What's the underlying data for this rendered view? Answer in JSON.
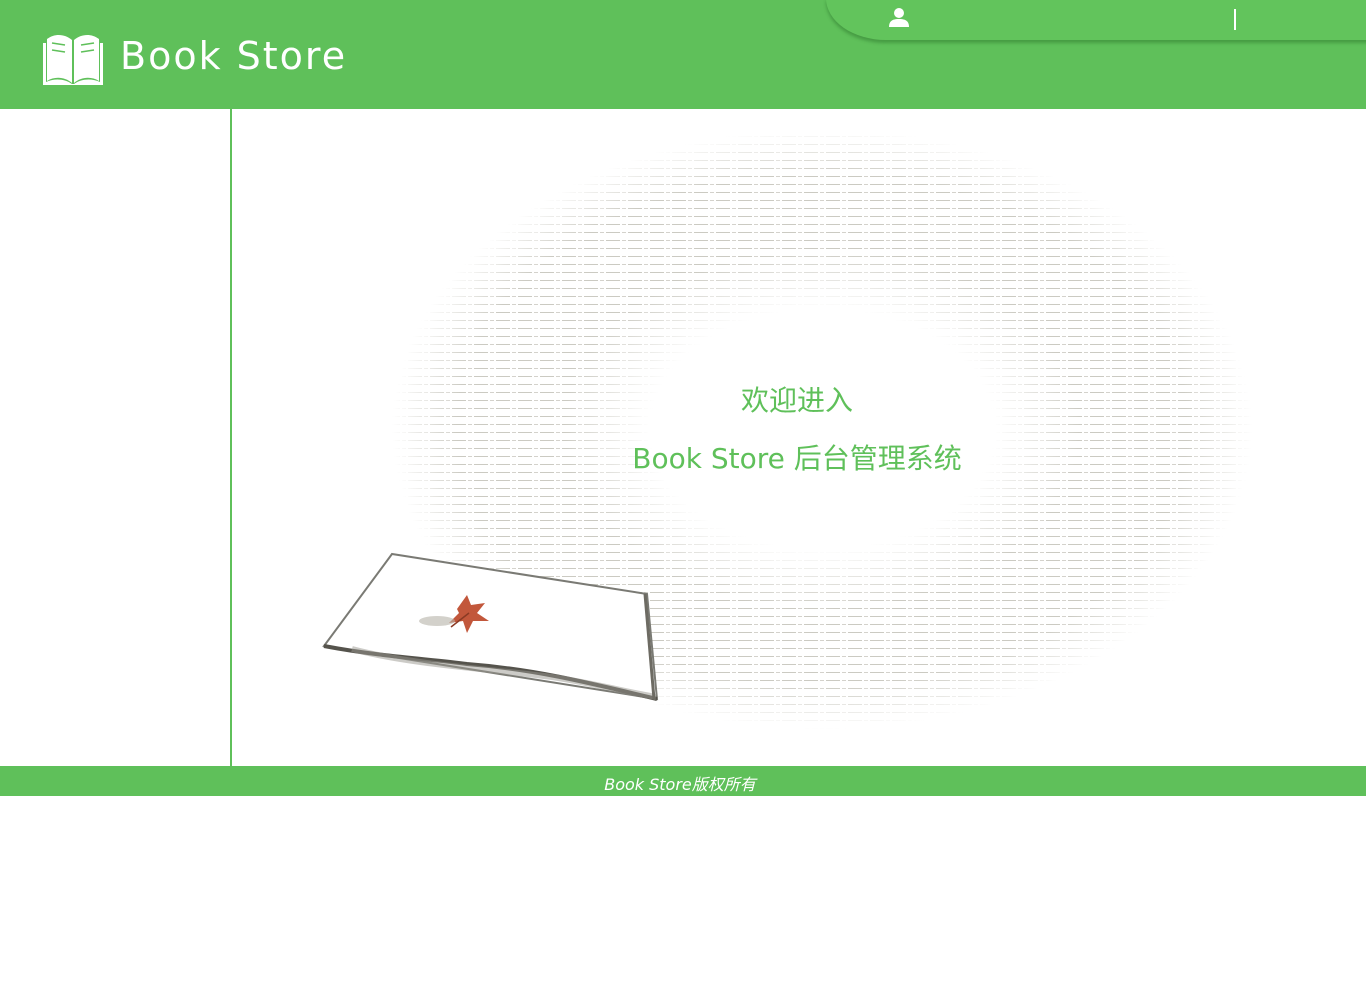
{
  "header": {
    "logo_text": "Book Store",
    "user_name": "",
    "logout_label": ""
  },
  "main": {
    "welcome_line1": "欢迎进入",
    "welcome_line2": "Book Store 后台管理系统"
  },
  "footer": {
    "copyright": "Book Store版权所有"
  },
  "icons": {
    "logo": "open-book-icon",
    "user": "user-icon",
    "decoration": "open-book-with-maple-leaf"
  },
  "colors": {
    "brand_green": "#5fc05a",
    "text_white": "#ffffff"
  }
}
